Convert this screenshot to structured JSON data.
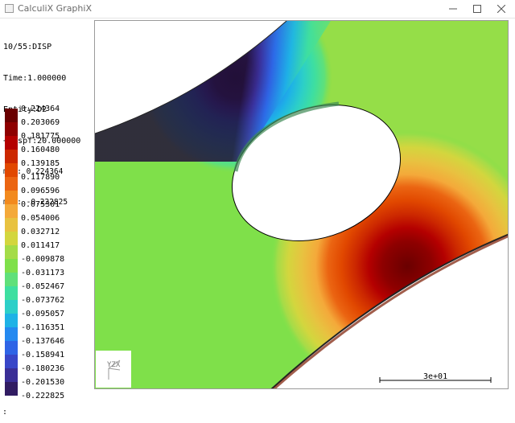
{
  "window": {
    "title": "CalculiX GraphiX",
    "icons": {
      "app": "app-icon",
      "minimize": "minimize-icon",
      "maximize": "maximize-icon",
      "close": "close-icon"
    }
  },
  "info_panel": {
    "dataset": "10/55:DISP",
    "time": "Time:1.000000",
    "entity": "Entity:D2",
    "dispf": "+Dispf:20.000000",
    "max": "max: 0.224364",
    "min": "min: -0.222825"
  },
  "legend": {
    "labels": [
      "0.224364",
      "0.203069",
      "0.181775",
      "0.160480",
      "0.139185",
      "0.117890",
      "0.096596",
      "0.075301",
      "0.054006",
      "0.032712",
      "0.011417",
      "-0.009878",
      "-0.031173",
      "-0.052467",
      "-0.073762",
      "-0.095057",
      "-0.116351",
      "-0.137646",
      "-0.158941",
      "-0.180236",
      "-0.201530",
      "-0.222825"
    ],
    "colors": [
      "#6a0000",
      "#8e0000",
      "#b40000",
      "#cc2800",
      "#e14800",
      "#eb6512",
      "#f28a1e",
      "#f4a93a",
      "#e8c240",
      "#d3d63e",
      "#a4dc48",
      "#7fe04a",
      "#5fe07a",
      "#3edfa0",
      "#2ccfc8",
      "#1eb2e6",
      "#2489f0",
      "#2e64e6",
      "#3846c8",
      "#3a2e96",
      "#311c62",
      "#221038"
    ]
  },
  "viewport": {
    "scale_label": "3e+01",
    "triad_label": "YZX"
  },
  "command_line": {
    "prompt": ":"
  }
}
